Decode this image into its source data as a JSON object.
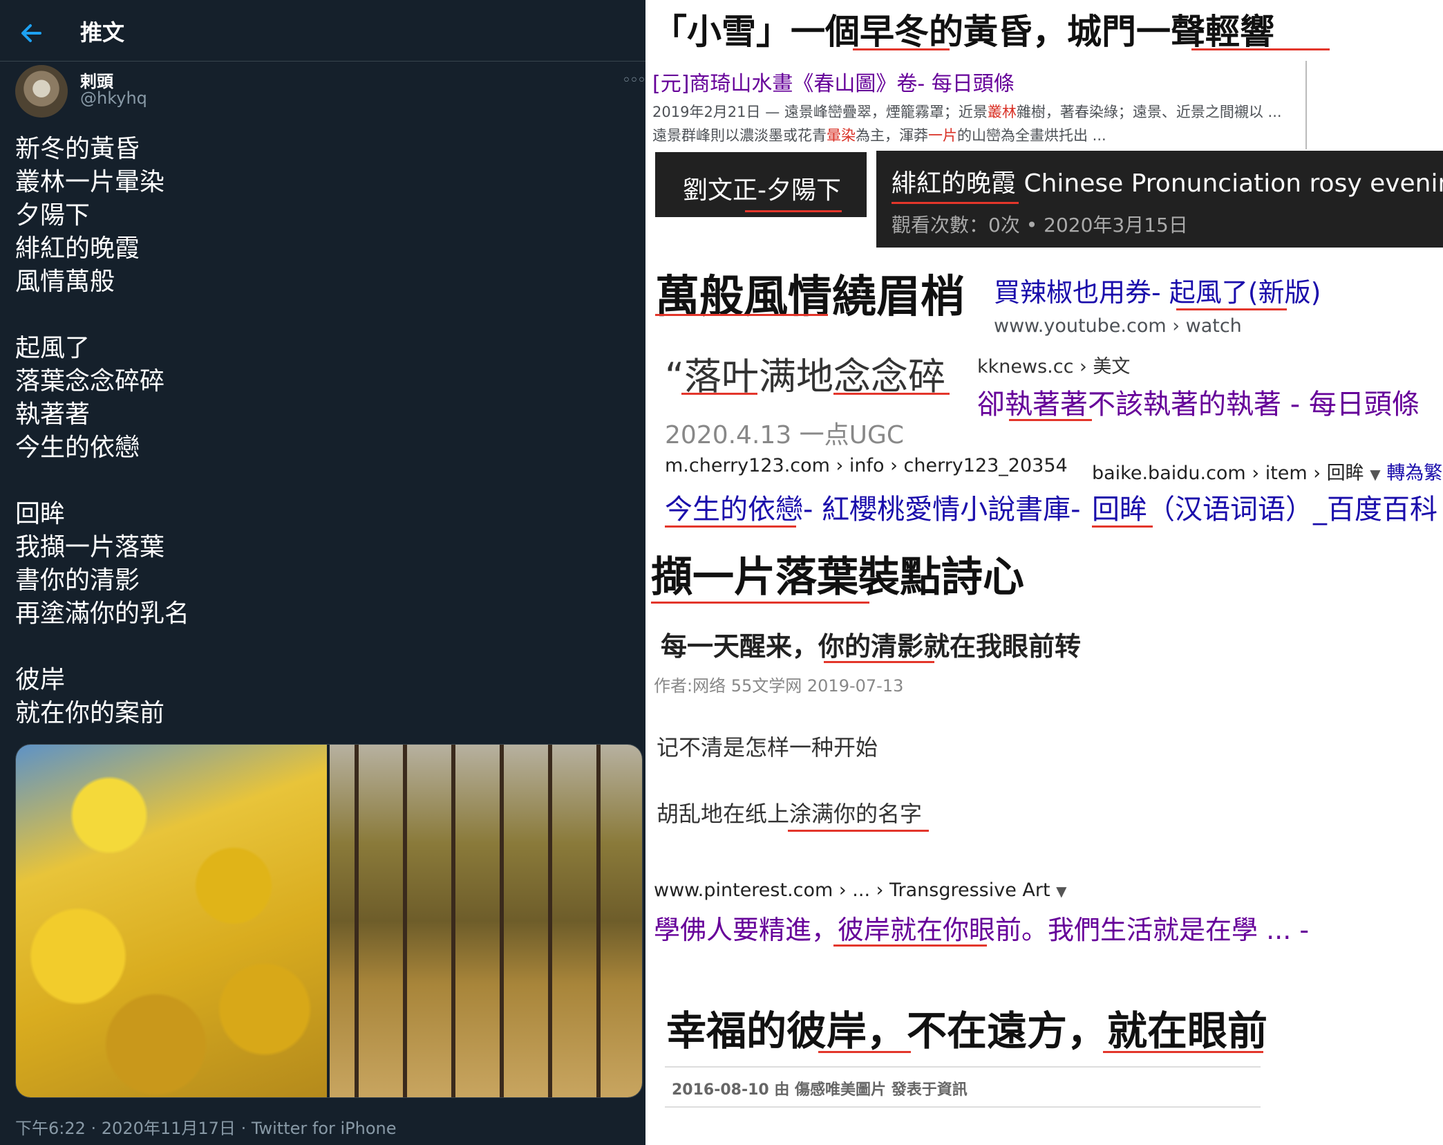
{
  "tweet": {
    "header_title": "推文",
    "author_name": "剌頭",
    "author_handle": "@hkyhq",
    "more": "◦◦◦",
    "lines": [
      "新冬的黃昏",
      "叢林一片暈染",
      "夕陽下",
      "緋紅的晚霞",
      "風情萬般",
      "",
      "起風了",
      "落葉念念碎碎",
      "執著著",
      "今生的依戀",
      "",
      "回眸",
      "我擷一片落葉",
      "書你的清影",
      "再塗滿你的乳名",
      "",
      "彼岸",
      "就在你的案前"
    ],
    "meta": "下午6:22 · 2020年11月17日 · Twitter for iPhone",
    "accent": "#1da1f2",
    "background": "#15202b"
  },
  "collage": {
    "headline1": "「小雪」一個早冬的黃昏，城門一聲輕響",
    "link1": "[元]商琦山水畫《春山圖》卷- 每日頭條",
    "snippet1_a": "2019年2月21日 — 遠景峰巒疊翠，煙籠霧罩；近景",
    "snippet1_b": "叢林",
    "snippet1_c": "雜樹，著春染綠；遠景、近景之間襯以 ...",
    "snippet2_a": "遠景群峰則以濃淡墨或花青",
    "snippet2_b": "暈染",
    "snippet2_c": "為主，渾莽",
    "snippet2_d": "一片",
    "snippet2_e": "的山巒為全畫烘托出 ...",
    "video1_title": "劉文正-夕陽下",
    "video2_title": "緋紅的晚霞 Chinese Pronunciation rosy evening cl",
    "video2_meta": "觀看次數：0次 • 2020年3月15日",
    "headline2": "萬般風情繞眉梢",
    "link2": "買辣椒也用券- 起風了(新版)",
    "link2_url": "www.youtube.com › watch",
    "quote1": "“落叶满地念念碎",
    "quote1_date": "2020.4.13  一点UGC",
    "kk_url": "kknews.cc › 美文",
    "kk_link": "卻執著著不該執著的執著 - 每日頭條",
    "cherry_url": "m.cherry123.com › info › cherry123_20354",
    "cherry_link": "今生的依戀- 紅櫻桃愛情小說書庫-",
    "baike_url": "baike.baidu.com › item › 回眸",
    "baike_convert": "轉為繁體",
    "baike_link": "回眸（汉语词语）_百度百科",
    "headline3": "擷一片落葉裝點詩心",
    "article_title": "每一天醒来，你的清影就在我眼前转",
    "article_meta": "作者:网络    55文学网    2019-07-13",
    "article_line1": "记不清是怎样一种开始",
    "article_line2": "胡乱地在纸上涂满你的名字",
    "pin_url": "www.pinterest.com › ... › Transgressive Art",
    "pin_link": "學佛人要精進，彼岸就在你眼前。我們生活就是在學 ... -",
    "headline4": "幸福的彼岸，不在遠方，就在眼前",
    "footer_meta": "2016-08-10 由 傷感唯美圖片 發表于資訊",
    "underline_color": "#e3362b"
  }
}
